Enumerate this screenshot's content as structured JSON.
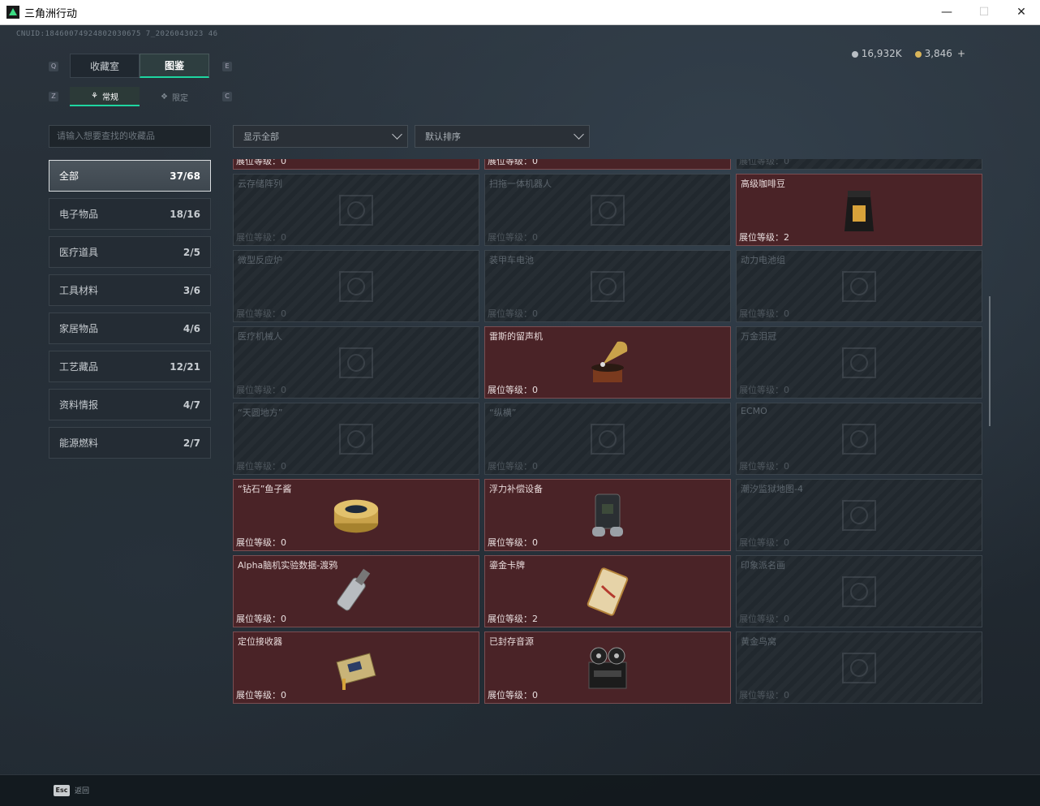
{
  "window": {
    "title": "三角洲行动"
  },
  "header": {
    "uid": "CNUID:18460074924802030675 7_2026043023 46",
    "currency_silver": "16,932K",
    "currency_gold": "3,846",
    "currency_add": "+"
  },
  "tabs": [
    {
      "label": "收藏室"
    },
    {
      "label": "图鉴"
    }
  ],
  "subtabs": [
    {
      "label": "常规"
    },
    {
      "label": "限定"
    }
  ],
  "search": {
    "placeholder": "请输入想要查找的收藏品"
  },
  "filters": {
    "display": "显示全部",
    "sort": "默认排序"
  },
  "categories": [
    {
      "label": "全部",
      "count": "37/68"
    },
    {
      "label": "电子物品",
      "count": "18/16"
    },
    {
      "label": "医疗道具",
      "count": "2/5"
    },
    {
      "label": "工具材料",
      "count": "3/6"
    },
    {
      "label": "家居物品",
      "count": "4/6"
    },
    {
      "label": "工艺藏品",
      "count": "12/21"
    },
    {
      "label": "资料情报",
      "count": "4/7"
    },
    {
      "label": "能源燃料",
      "count": "2/7"
    }
  ],
  "grid": {
    "level_label": "展位等级：",
    "items": [
      {
        "name": "",
        "level": "0",
        "owned": true,
        "icon": "jerrycan-icon"
      },
      {
        "name": "",
        "level": "0",
        "owned": true,
        "icon": "terminal-icon"
      },
      {
        "name": "",
        "level": "0",
        "owned": false,
        "icon": "device-icon"
      },
      {
        "name": "云存储阵列",
        "level": "0",
        "owned": false,
        "icon": "server-icon"
      },
      {
        "name": "扫拖一体机器人",
        "level": "0",
        "owned": false,
        "icon": "robot-icon"
      },
      {
        "name": "高级咖啡豆",
        "level": "2",
        "owned": true,
        "icon": "coffee-bag-icon"
      },
      {
        "name": "微型反应炉",
        "level": "0",
        "owned": false,
        "icon": "reactor-icon"
      },
      {
        "name": "装甲车电池",
        "level": "0",
        "owned": false,
        "icon": "battery-icon"
      },
      {
        "name": "动力电池组",
        "level": "0",
        "owned": false,
        "icon": "battery-pack-icon"
      },
      {
        "name": "医疗机械人",
        "level": "0",
        "owned": false,
        "icon": "medical-robot-icon"
      },
      {
        "name": "雷斯的留声机",
        "level": "0",
        "owned": true,
        "icon": "gramophone-icon"
      },
      {
        "name": "万金泪冠",
        "level": "0",
        "owned": false,
        "icon": "crown-icon"
      },
      {
        "name": "“天圆地方”",
        "level": "0",
        "owned": false,
        "icon": "globe-icon"
      },
      {
        "name": "“纵横”",
        "level": "0",
        "owned": false,
        "icon": "board-icon"
      },
      {
        "name": "ECMO",
        "level": "0",
        "owned": false,
        "icon": "ecmo-icon"
      },
      {
        "name": "“钻石”鱼子酱",
        "level": "0",
        "owned": true,
        "icon": "caviar-icon"
      },
      {
        "name": "浮力补偿设备",
        "level": "0",
        "owned": true,
        "icon": "diving-gear-icon"
      },
      {
        "name": "潮汐监狱地图-4",
        "level": "0",
        "owned": false,
        "icon": "map-icon"
      },
      {
        "name": "Alpha脑机实验数据-渡鸦",
        "level": "0",
        "owned": true,
        "icon": "data-drive-icon"
      },
      {
        "name": "鎏金卡牌",
        "level": "2",
        "owned": true,
        "icon": "gold-card-icon"
      },
      {
        "name": "印象派名画",
        "level": "0",
        "owned": false,
        "icon": "painting-icon"
      },
      {
        "name": "定位接收器",
        "level": "0",
        "owned": true,
        "icon": "receiver-icon"
      },
      {
        "name": "已封存音源",
        "level": "0",
        "owned": true,
        "icon": "tape-recorder-icon"
      },
      {
        "name": "黄金鸟窝",
        "level": "0",
        "owned": false,
        "icon": "nest-icon"
      }
    ]
  },
  "footer": {
    "esc_key": "Esc",
    "esc_label": "返回"
  }
}
